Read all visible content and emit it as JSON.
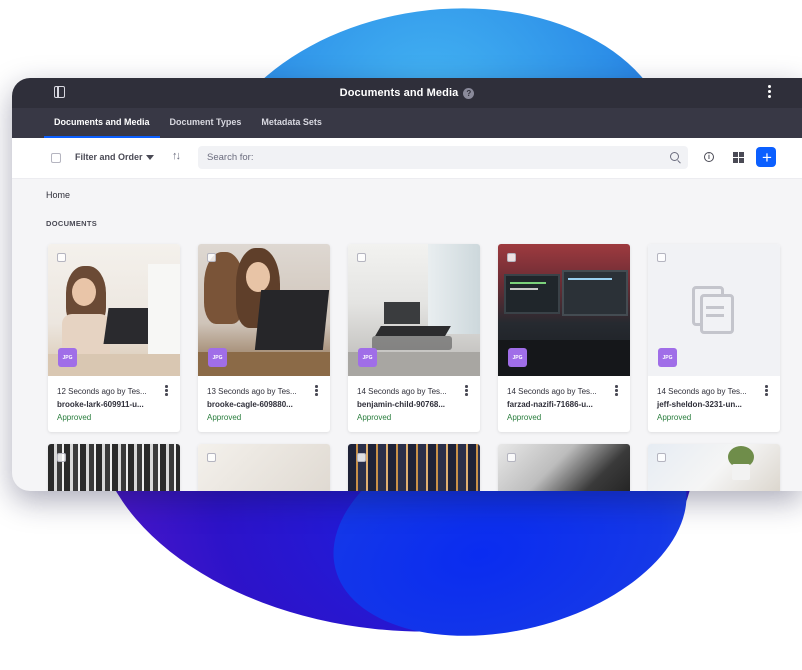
{
  "window": {
    "title": "Documents and Media",
    "help_icon": "?"
  },
  "tabs": [
    {
      "label": "Documents and Media",
      "active": true
    },
    {
      "label": "Document Types",
      "active": false
    },
    {
      "label": "Metadata Sets",
      "active": false
    }
  ],
  "toolbar": {
    "filter_label": "Filter and Order",
    "sort_icon": "↑↓",
    "search_placeholder": "Search for:",
    "info_icon": "i",
    "add_label": "+"
  },
  "breadcrumb": "Home",
  "section_title": "DOCUMENTS",
  "colors": {
    "accent": "#0b5fff",
    "approved": "#287d3c",
    "badge": "#a06ee8"
  },
  "documents": [
    {
      "meta": "12 Seconds ago by Tes...",
      "name": "brooke-lark-609911-u...",
      "status": "Approved",
      "badge": "JPG"
    },
    {
      "meta": "13 Seconds ago by Tes...",
      "name": "brooke-cagle-609880...",
      "status": "Approved",
      "badge": "JPG"
    },
    {
      "meta": "14 Seconds ago by Tes...",
      "name": "benjamin-child-90768...",
      "status": "Approved",
      "badge": "JPG"
    },
    {
      "meta": "14 Seconds ago by Tes...",
      "name": "farzad-nazifi-71686-u...",
      "status": "Approved",
      "badge": "JPG"
    },
    {
      "meta": "14 Seconds ago by Tes...",
      "name": "jeff-sheldon-3231-un...",
      "status": "Approved",
      "badge": "JPG"
    }
  ]
}
